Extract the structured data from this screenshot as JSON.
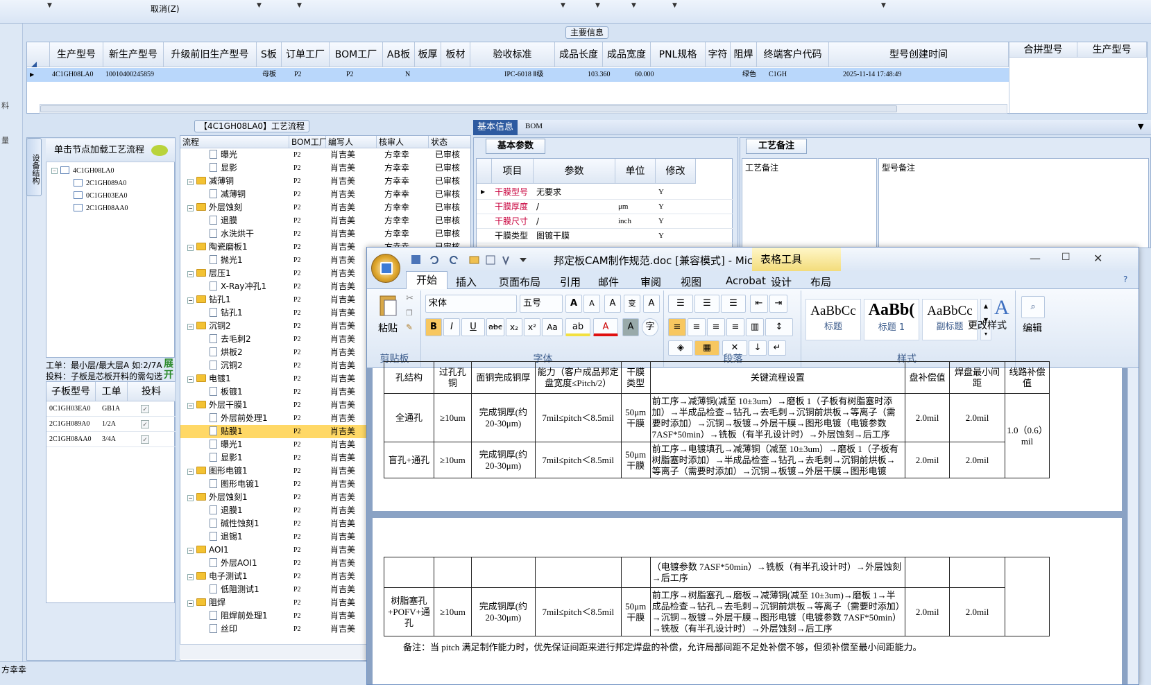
{
  "toolbar": {
    "cancel_label": "取消(Z)"
  },
  "left_strip": {
    "labels": [
      "料",
      "量"
    ]
  },
  "main_info": {
    "legend": "主要信息",
    "columns": [
      "生产型号",
      "新生产型号",
      "升级前旧生产型号",
      "S板",
      "订单工厂",
      "BOM工厂",
      "AB板",
      "板厚",
      "板材",
      "验收标准",
      "成品长度",
      "成品宽度",
      "PNL规格",
      "字符",
      "阻焊",
      "终端客户代码",
      "型号创建时间"
    ],
    "right_columns": [
      "合拼型号",
      "生产型号"
    ],
    "row": {
      "prod_model": "4C1GH08LA0",
      "new_model": "10010400245859",
      "s_board": "母板",
      "order_factory": "P2",
      "bom_factory": "P2",
      "ab_board": "N",
      "standard": "IPC-6018 Ⅱ级",
      "length": "103.360",
      "width": "60.000",
      "solder": "绿色",
      "customer": "C1GH",
      "created": "2025-11-14 17:48:49"
    }
  },
  "process": {
    "title": "【4C1GH08LA0】工艺流程",
    "vtab": "设备结构",
    "tree_header": "单击节点加载工艺流程",
    "tree_root": "4C1GH08LA0",
    "tree_children": [
      "2C1GH089A0",
      "0C1GH03EA0",
      "2C1GH08AA0"
    ],
    "info_line1": "工单：最小层/最大层A 如:2/7A",
    "info_line2": "投料：子板是芯板开料的需勾选",
    "expand": "展开",
    "sub_columns": [
      "子板型号",
      "工单",
      "投料"
    ],
    "sub_rows": [
      {
        "model": "0C1GH03EA0",
        "order": "GB1A",
        "checked": "✓"
      },
      {
        "model": "2C1GH089A0",
        "order": "1/2A",
        "checked": "✓"
      },
      {
        "model": "2C1GH08AA0",
        "order": "3/4A",
        "checked": "✓"
      }
    ]
  },
  "flow": {
    "columns": [
      "流程",
      "BOM工厂",
      "编写人",
      "核审人",
      "状态"
    ],
    "rows": [
      {
        "level": 1,
        "name": "曝光",
        "bom": "P2",
        "writer": "肖吉美",
        "reviewer": "方幸幸",
        "status": "已审核"
      },
      {
        "level": 1,
        "name": "显影",
        "bom": "P2",
        "writer": "肖吉美",
        "reviewer": "方幸幸",
        "status": "已审核"
      },
      {
        "level": 0,
        "name": "减薄铜",
        "bom": "P2",
        "writer": "肖吉美",
        "reviewer": "方幸幸",
        "status": "已审核"
      },
      {
        "level": 1,
        "name": "减薄铜",
        "bom": "P2",
        "writer": "肖吉美",
        "reviewer": "方幸幸",
        "status": "已审核"
      },
      {
        "level": 0,
        "name": "外层蚀刻",
        "bom": "P2",
        "writer": "肖吉美",
        "reviewer": "方幸幸",
        "status": "已审核"
      },
      {
        "level": 1,
        "name": "退膜",
        "bom": "P2",
        "writer": "肖吉美",
        "reviewer": "方幸幸",
        "status": "已审核"
      },
      {
        "level": 1,
        "name": "水洗烘干",
        "bom": "P2",
        "writer": "肖吉美",
        "reviewer": "方幸幸",
        "status": "已审核"
      },
      {
        "level": 0,
        "name": "陶瓷磨板1",
        "bom": "P2",
        "writer": "肖吉美",
        "reviewer": "方幸幸",
        "status": "已审核"
      },
      {
        "level": 1,
        "name": "抛光1",
        "bom": "P2",
        "writer": "肖吉美",
        "reviewer": "",
        "status": ""
      },
      {
        "level": 0,
        "name": "层压1",
        "bom": "P2",
        "writer": "肖吉美",
        "reviewer": "",
        "status": ""
      },
      {
        "level": 1,
        "name": "X-Ray冲孔1",
        "bom": "P2",
        "writer": "肖吉美",
        "reviewer": "",
        "status": ""
      },
      {
        "level": 0,
        "name": "钻孔1",
        "bom": "P2",
        "writer": "肖吉美",
        "reviewer": "",
        "status": ""
      },
      {
        "level": 1,
        "name": "钻孔1",
        "bom": "P2",
        "writer": "肖吉美",
        "reviewer": "",
        "status": ""
      },
      {
        "level": 0,
        "name": "沉铜2",
        "bom": "P2",
        "writer": "肖吉美",
        "reviewer": "",
        "status": ""
      },
      {
        "level": 1,
        "name": "去毛刺2",
        "bom": "P2",
        "writer": "肖吉美",
        "reviewer": "",
        "status": ""
      },
      {
        "level": 1,
        "name": "烘板2",
        "bom": "P2",
        "writer": "肖吉美",
        "reviewer": "",
        "status": ""
      },
      {
        "level": 1,
        "name": "沉铜2",
        "bom": "P2",
        "writer": "肖吉美",
        "reviewer": "",
        "status": ""
      },
      {
        "level": 0,
        "name": "电镀1",
        "bom": "P2",
        "writer": "肖吉美",
        "reviewer": "",
        "status": ""
      },
      {
        "level": 1,
        "name": "板镀1",
        "bom": "P2",
        "writer": "肖吉美",
        "reviewer": "",
        "status": ""
      },
      {
        "level": 0,
        "name": "外层干膜1",
        "bom": "P2",
        "writer": "肖吉美",
        "reviewer": "",
        "status": ""
      },
      {
        "level": 1,
        "name": "外层前处理1",
        "bom": "P2",
        "writer": "肖吉美",
        "reviewer": "",
        "status": ""
      },
      {
        "level": 1,
        "name": "贴膜1",
        "bom": "P2",
        "writer": "肖吉美",
        "reviewer": "",
        "status": "",
        "selected": true
      },
      {
        "level": 1,
        "name": "曝光1",
        "bom": "P2",
        "writer": "肖吉美",
        "reviewer": "",
        "status": ""
      },
      {
        "level": 1,
        "name": "显影1",
        "bom": "P2",
        "writer": "肖吉美",
        "reviewer": "",
        "status": ""
      },
      {
        "level": 0,
        "name": "图形电镀1",
        "bom": "P2",
        "writer": "肖吉美",
        "reviewer": "",
        "status": ""
      },
      {
        "level": 1,
        "name": "图形电镀1",
        "bom": "P2",
        "writer": "肖吉美",
        "reviewer": "",
        "status": ""
      },
      {
        "level": 0,
        "name": "外层蚀刻1",
        "bom": "P2",
        "writer": "肖吉美",
        "reviewer": "",
        "status": ""
      },
      {
        "level": 1,
        "name": "退膜1",
        "bom": "P2",
        "writer": "肖吉美",
        "reviewer": "",
        "status": ""
      },
      {
        "level": 1,
        "name": "碱性蚀刻1",
        "bom": "P2",
        "writer": "肖吉美",
        "reviewer": "",
        "status": ""
      },
      {
        "level": 1,
        "name": "退锡1",
        "bom": "P2",
        "writer": "肖吉美",
        "reviewer": "",
        "status": ""
      },
      {
        "level": 0,
        "name": "AOI1",
        "bom": "P2",
        "writer": "肖吉美",
        "reviewer": "",
        "status": ""
      },
      {
        "level": 1,
        "name": "外层AOI1",
        "bom": "P2",
        "writer": "肖吉美",
        "reviewer": "",
        "status": ""
      },
      {
        "level": 0,
        "name": "电子测试1",
        "bom": "P2",
        "writer": "肖吉美",
        "reviewer": "",
        "status": ""
      },
      {
        "level": 1,
        "name": "低阻测试1",
        "bom": "P2",
        "writer": "肖吉美",
        "reviewer": "",
        "status": ""
      },
      {
        "level": 0,
        "name": "阻焊",
        "bom": "P2",
        "writer": "肖吉美",
        "reviewer": "",
        "status": ""
      },
      {
        "level": 1,
        "name": "阻焊前处理1",
        "bom": "P2",
        "writer": "肖吉美",
        "reviewer": "",
        "status": ""
      },
      {
        "level": 1,
        "name": "丝印",
        "bom": "P2",
        "writer": "肖吉美",
        "reviewer": "",
        "status": ""
      }
    ]
  },
  "basic": {
    "tab_basic": "基本信息",
    "tab_bom": "BOM",
    "legend": "基本参数",
    "columns": [
      "项目",
      "参数",
      "单位",
      "修改"
    ],
    "rows": [
      {
        "item": "干膜型号",
        "param": "无要求",
        "unit": "",
        "edit": "Y"
      },
      {
        "item": "干膜厚度",
        "param": "/",
        "unit": "μm",
        "edit": "Y"
      },
      {
        "item": "干膜尺寸",
        "param": "/",
        "unit": "inch",
        "edit": "Y"
      },
      {
        "item": "干膜类型",
        "param": "图镀干膜",
        "unit": "",
        "edit": "Y"
      }
    ]
  },
  "notes": {
    "legend": "工艺备注",
    "col1": "工艺备注",
    "col2": "型号备注"
  },
  "word": {
    "title": "邦定板CAM制作规范.doc [兼容模式] - Micr...",
    "table_tools": "表格工具",
    "tabs": [
      "开始",
      "插入",
      "页面布局",
      "引用",
      "邮件",
      "审阅",
      "视图",
      "Acrobat",
      "设计",
      "布局"
    ],
    "font_name": "宋体",
    "font_size": "五号",
    "groups": {
      "clipboard": "剪贴板",
      "paste": "粘贴",
      "font": "字体",
      "paragraph": "段落",
      "styles": "样式",
      "change_styles": "更改样式",
      "edit": "编辑"
    },
    "styles": [
      {
        "preview": "AaBbCc",
        "label": "标题"
      },
      {
        "preview": "AaBb(",
        "label": "标题 1"
      },
      {
        "preview": "AaBbCc",
        "label": "副标题"
      }
    ],
    "doc": {
      "headers": [
        "孔结构",
        "过孔孔铜",
        "面铜完成铜厚",
        "能力（客户成品邦定盘宽度≤Pitch/2）",
        "干膜类型",
        "关键流程设置",
        "盘补偿值",
        "焊盘最小间距",
        "线路补偿值"
      ],
      "rows": [
        {
          "a": "全通孔",
          "b": "≥10um",
          "c": "完成铜厚(约 20-30μm)",
          "d": "7mil≤pitch＜8.5mil",
          "e": "50μm干膜",
          "f": "前工序→减薄铜(减至 10±3um）→磨板 1（子板有树脂塞时添加）→半成品检查→钻孔→去毛刺→沉铜前烘板→等离子（需要时添加）→沉铜→板镀→外层干膜→图形电镀（电镀参数 7ASF*50min）→铣板（有半孔设计时）→外层蚀刻→后工序",
          "g": "2.0mil",
          "h": "2.0mil"
        },
        {
          "a": "盲孔+通孔",
          "b": "≥10um",
          "c": "完成铜厚(约 20-30μm)",
          "d": "7mil≤pitch＜8.5mil",
          "e": "50μm干膜",
          "f": "前工序→电镀填孔→减薄铜（减至 10±3um）→磨板 1（子板有树脂塞时添加）→半成品检查→钻孔→去毛刺→沉铜前烘板→等离子（需要时添加）→沉铜→板镀→外层干膜→图形电镀",
          "g": "2.0mil",
          "h": "2.0mil"
        }
      ],
      "line_comp": "1.0（0.6）mil",
      "cont_text": "（电镀参数 7ASF*50min）→铣板（有半孔设计时）→外层蚀刻→后工序",
      "row3": {
        "a": "树脂塞孔+POFV+通孔",
        "b": "≥10um",
        "c": "完成铜厚(约 20-30μm)",
        "d": "7mil≤pitch＜8.5mil",
        "e": "50μm干膜",
        "f": "前工序→树脂塞孔→磨板→减薄铜(减至 10±3um)→磨板 1→半成品检查→钻孔→去毛刺→沉铜前烘板→等离子（需要时添加）→沉铜→板镀→外层干膜→图形电镀（电镀参数 7ASF*50min）→铣板（有半孔设计时）→外层蚀刻→后工序",
        "g": "2.0mil",
        "h": "2.0mil"
      },
      "note": "备注：当 pitch 满足制作能力时，优先保证间距来进行邦定焊盘的补偿，允许局部间距不足处补偿不够，但须补偿至最小间距能力。"
    }
  },
  "status": {
    "user": "方幸幸"
  },
  "colors": {
    "selection": "#b9d7fb",
    "flow_selected": "#ffd866",
    "param_red": "#c8003c",
    "word_blue": "#2d5aa0"
  }
}
